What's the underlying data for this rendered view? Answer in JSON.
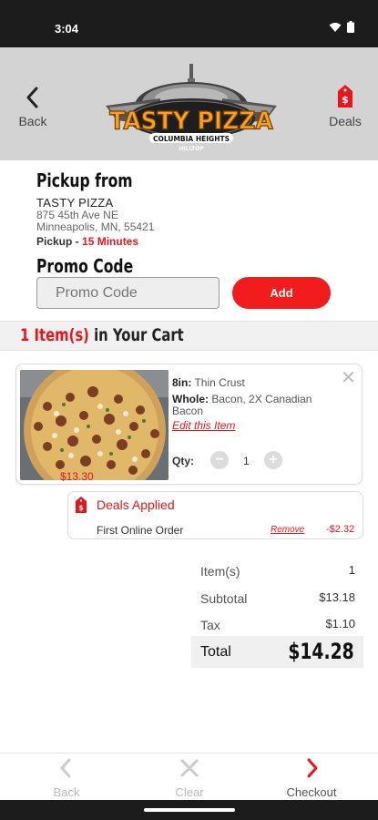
{
  "status": {
    "time": "3:04"
  },
  "header": {
    "back_label": "Back",
    "deals_label": "Deals",
    "logo_text": "TASTY PIZZA",
    "logo_subtext": "COLUMBIA HEIGHTS",
    "logo_subtext2": "HILLTOP"
  },
  "pickup": {
    "title": "Pickup from",
    "store_name": "TASTY PIZZA",
    "address_line1": "875 45th Ave NE",
    "address_line2": "Minneapolis, MN, 55421",
    "time_label": "Pickup - ",
    "time_value": "15 Minutes"
  },
  "promo": {
    "title": "Promo Code",
    "placeholder": "Promo Code",
    "add_label": "Add"
  },
  "cart": {
    "count": "1 Item(s)",
    "count_suffix": " in Your Cart"
  },
  "item": {
    "size_label": "8in:",
    "size_value": "Thin Crust",
    "toppings_label": "Whole:",
    "toppings_value": "Bacon, 2X Canadian Bacon",
    "edit_label": "Edit this Item",
    "qty_label": "Qty:",
    "qty_minus": "−",
    "qty_value": "1",
    "qty_plus": "+",
    "price": "$13.30"
  },
  "deals": {
    "title": "Deals Applied",
    "name": "First Online Order",
    "remove_label": "Remove",
    "amount": "-$2.32"
  },
  "totals": {
    "items_label": "Item(s)",
    "items_value": "1",
    "subtotal_label": "Subtotal",
    "subtotal_value": "$13.18",
    "tax_label": "Tax",
    "tax_value": "$1.10",
    "total_label": "Total",
    "total_value": "$14.28"
  },
  "nav": {
    "back": "Back",
    "clear": "Clear",
    "checkout": "Checkout"
  },
  "colors": {
    "accent": "#e8151b",
    "header_bg": "#d3d3d3"
  }
}
